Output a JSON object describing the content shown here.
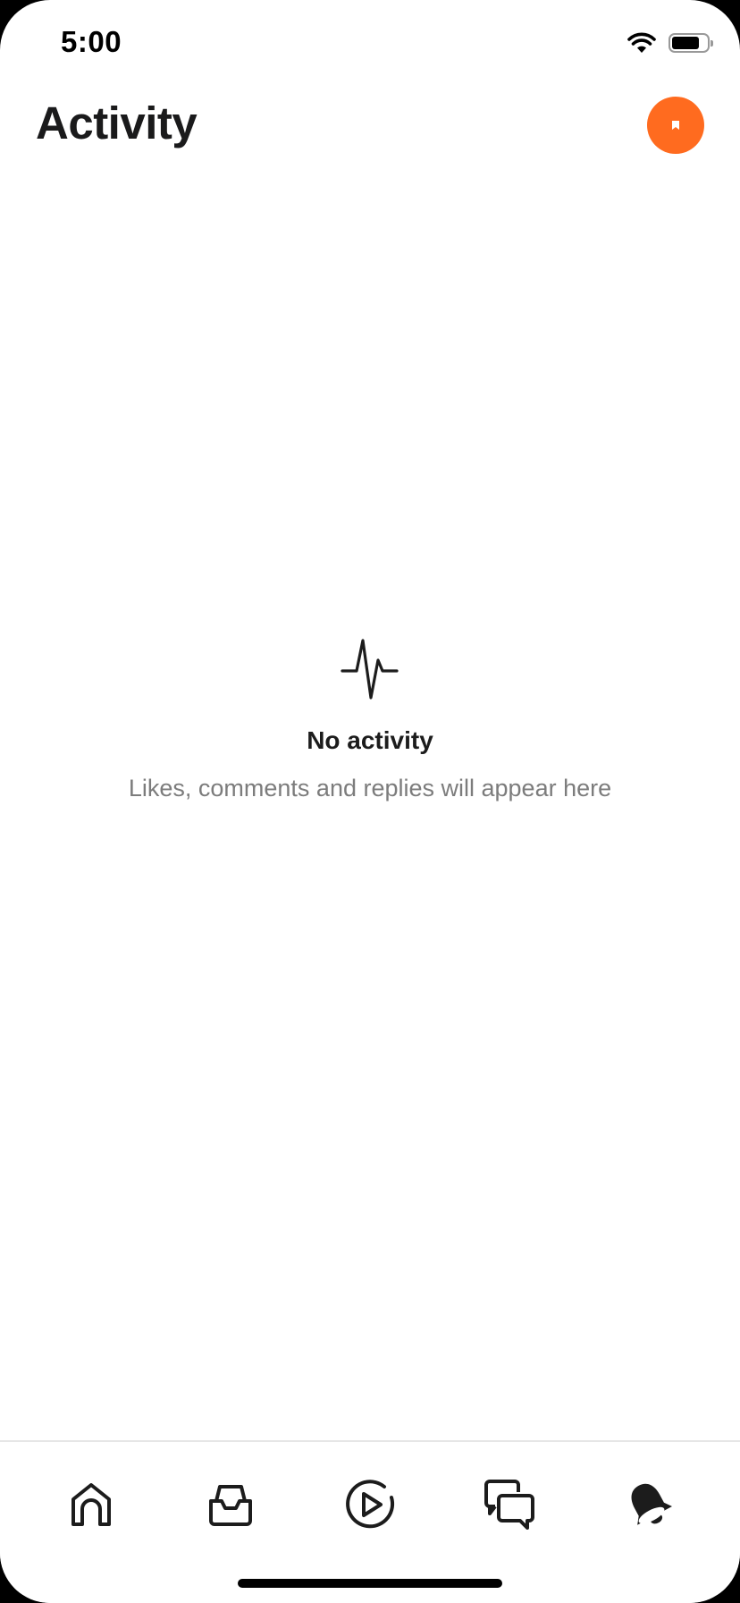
{
  "status_bar": {
    "time": "5:00",
    "wifi_icon": "wifi-icon",
    "battery_icon": "battery-icon",
    "battery_level": 0.8
  },
  "header": {
    "title": "Activity",
    "avatar_icon": "user-avatar-icon",
    "avatar_color": "#ff6b1f"
  },
  "empty_state": {
    "icon": "activity-pulse-icon",
    "title": "No activity",
    "subtitle": "Likes, comments and replies will appear here"
  },
  "tab_bar": {
    "tabs": [
      {
        "icon": "home-icon",
        "active": false
      },
      {
        "icon": "inbox-icon",
        "active": false
      },
      {
        "icon": "play-video-icon",
        "active": false
      },
      {
        "icon": "chat-icon",
        "active": false
      },
      {
        "icon": "notifications-bell-icon",
        "active": true
      }
    ]
  }
}
